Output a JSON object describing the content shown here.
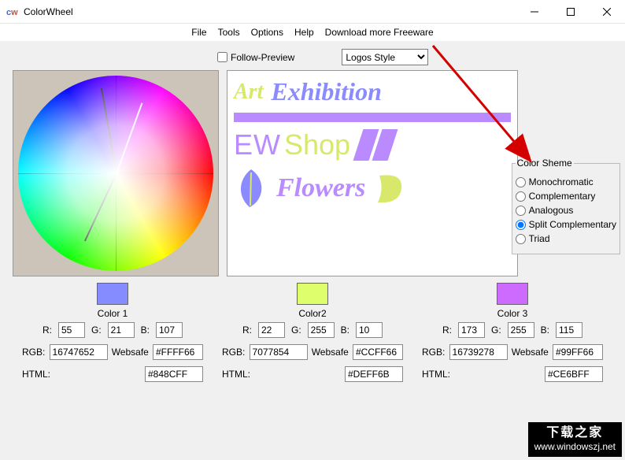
{
  "window": {
    "title": "ColorWheel"
  },
  "menu": {
    "file": "File",
    "tools": "Tools",
    "options": "Options",
    "help": "Help",
    "download": "Download more Freeware"
  },
  "controls": {
    "follow_preview": "Follow-Preview",
    "select_value": "Logos Style"
  },
  "preview": {
    "art": "Art",
    "exhibition": "Exhibition",
    "ew": "EW",
    "shop": "Shop",
    "flowers": "Flowers"
  },
  "scheme": {
    "legend": "Color Sheme",
    "options": [
      "Monochromatic",
      "Complementary",
      "Analogous",
      "Split Complementary",
      "Triad"
    ],
    "selected": 3
  },
  "swatches": [
    {
      "label": "Color 1",
      "hex": "#848CFF",
      "r": "55",
      "g": "21",
      "b": "107",
      "rgb": "16747652",
      "websafe": "#FFFF66",
      "html": "#848CFF"
    },
    {
      "label": "Color2",
      "hex": "#DEFF6B",
      "r": "22",
      "g": "255",
      "b": "10",
      "rgb": "7077854",
      "websafe": "#CCFF66",
      "html": "#DEFF6B"
    },
    {
      "label": "Color 3",
      "hex": "#CE6BFF",
      "r": "173",
      "g": "255",
      "b": "115",
      "rgb": "16739278",
      "websafe": "#99FF66",
      "html": "#CE6BFF"
    }
  ],
  "labels": {
    "r": "R:",
    "g": "G:",
    "b": "B:",
    "rgb": "RGB:",
    "websafe": "Websafe",
    "html": "HTML:"
  },
  "watermark": {
    "top": "下载之家",
    "bottom": "www.windowszj.net"
  }
}
